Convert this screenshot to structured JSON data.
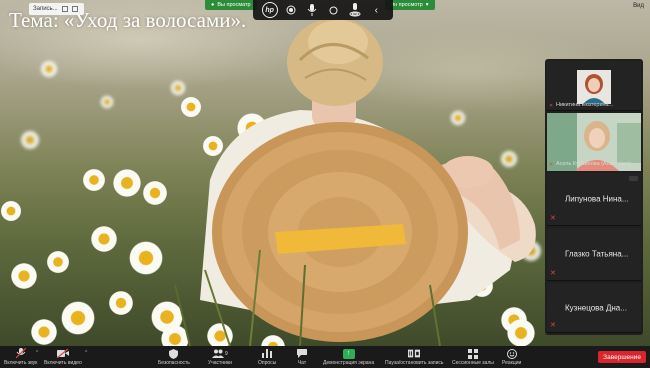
{
  "slide": {
    "title": "Тема: «Уход за волосами»."
  },
  "topbar": {
    "recording_label": "Запись...",
    "viewing_left": "Вы просматр",
    "viewing_right": "йн просмотр",
    "right_corner": "Вид"
  },
  "float_toolbar": {
    "items": [
      "hp-logo",
      "record-dot",
      "microphone",
      "circle",
      "spotlight",
      "collapse"
    ]
  },
  "panel": {
    "tiles": [
      {
        "name": "Никитина Екатерина..."
      },
      {
        "name": "Асель Кусаинова (Ассистент)"
      },
      {
        "name": "Липунова Нина..."
      },
      {
        "name": "Глазко Татьяна..."
      },
      {
        "name": "Кузнецова Дна..."
      }
    ]
  },
  "toolbar": {
    "mute": "Включить звук",
    "video": "Включить видео",
    "security": "Безопасность",
    "participants": "Участники",
    "participants_count": "9",
    "polls": "Опросы",
    "chat": "Чат",
    "share": "Демонстрация экрана",
    "record": "Пауза/остановить запись",
    "breakout": "Сессионные залы",
    "reactions": "Реакции",
    "end": "Завершение"
  },
  "colors": {
    "accent_green": "#2fae56",
    "end_red": "#d9252b",
    "muted_red": "#e0473c"
  }
}
